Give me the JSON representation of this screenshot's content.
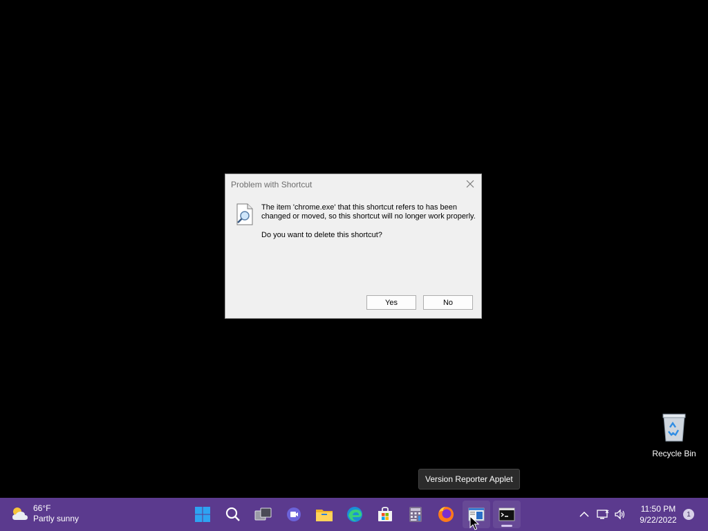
{
  "dialog": {
    "title": "Problem with Shortcut",
    "message": "The item 'chrome.exe' that this shortcut refers to has been changed or moved, so this shortcut will no longer work properly.",
    "question": "Do you want to delete this shortcut?",
    "yes_label": "Yes",
    "no_label": "No"
  },
  "desktop": {
    "recycle_bin_label": "Recycle Bin"
  },
  "tooltip": {
    "text": "Version Reporter Applet"
  },
  "taskbar": {
    "weather": {
      "temp": "66°F",
      "condition": "Partly sunny"
    },
    "apps": [
      "start-icon",
      "search-icon",
      "task-view-icon",
      "chat-icon",
      "file-explorer-icon",
      "edge-icon",
      "store-icon",
      "calculator-icon",
      "firefox-icon",
      "version-reporter-icon",
      "terminal-icon"
    ],
    "clock": {
      "time": "11:50 PM",
      "date": "9/22/2022"
    },
    "notification_count": "1"
  },
  "colors": {
    "taskbar": "#5b3a8e",
    "desktop": "#000000",
    "dialog_bg": "#f0f0f0"
  }
}
